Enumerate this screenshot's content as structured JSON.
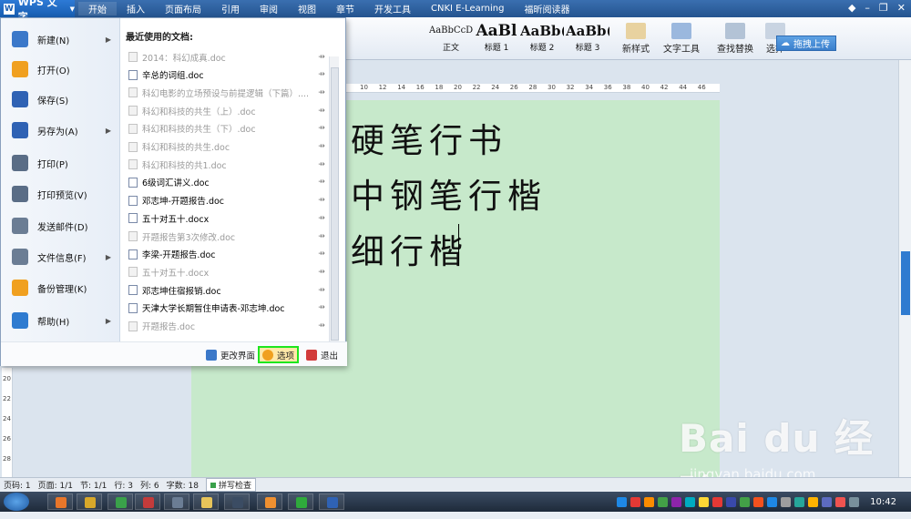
{
  "app": {
    "title": "WPS 文字",
    "logo": "W"
  },
  "menu_tabs": [
    "开始",
    "插入",
    "页面布局",
    "引用",
    "审阅",
    "视图",
    "章节",
    "开发工具",
    "CNKI E-Learning",
    "福昕阅读器"
  ],
  "ribbon": {
    "styles": [
      {
        "sample": "AaBbCcDd",
        "caption": "正文"
      },
      {
        "sample": "AaBl",
        "caption": "标题 1"
      },
      {
        "sample": "AaBb(",
        "caption": "标题 2"
      },
      {
        "sample": "AaBb(",
        "caption": "标题 3"
      }
    ],
    "buttons": [
      "新样式",
      "文字工具",
      "查找替换",
      "选择"
    ],
    "upload_label": "拖拽上传"
  },
  "ruler_ticks": [
    "10",
    "12",
    "14",
    "16",
    "18",
    "20",
    "22",
    "24",
    "26",
    "28",
    "30",
    "32",
    "34",
    "36",
    "38",
    "40",
    "42",
    "44",
    "46"
  ],
  "vruler_ticks": [
    "20",
    "22",
    "24",
    "26",
    "28"
  ],
  "document": {
    "lines": [
      "硬笔行书",
      "中钢笔行楷",
      "细行楷"
    ]
  },
  "file_menu": {
    "commands": [
      {
        "label": "新建(N)",
        "submenu": true,
        "icon": "new-doc-icon",
        "color": "#3b78c9"
      },
      {
        "label": "打开(O)",
        "submenu": false,
        "icon": "open-folder-icon",
        "color": "#f0a020"
      },
      {
        "label": "保存(S)",
        "submenu": false,
        "icon": "save-icon",
        "color": "#2f62b4"
      },
      {
        "label": "另存为(A)",
        "submenu": true,
        "icon": "save-as-icon",
        "color": "#2f62b4"
      },
      {
        "label": "打印(P)",
        "submenu": false,
        "icon": "print-icon",
        "color": "#5a6d86"
      },
      {
        "label": "打印预览(V)",
        "submenu": false,
        "icon": "print-preview-icon",
        "color": "#5a6d86"
      },
      {
        "label": "发送邮件(D)",
        "submenu": false,
        "icon": "mail-icon",
        "color": "#6b7d94"
      },
      {
        "label": "文件信息(F)",
        "submenu": true,
        "icon": "file-info-icon",
        "color": "#6b7d94"
      },
      {
        "label": "备份管理(K)",
        "submenu": false,
        "icon": "backup-icon",
        "color": "#f0a020"
      },
      {
        "label": "帮助(H)",
        "submenu": true,
        "icon": "help-icon",
        "color": "#2f7bd0"
      }
    ],
    "recent_title": "最近使用的文档:",
    "recent": [
      {
        "name": "2014：科幻成真.doc",
        "dim": true
      },
      {
        "name": "辛总的词组.doc",
        "dim": false
      },
      {
        "name": "科幻电影的立场预设与前提逻辑（下篇）....",
        "dim": true
      },
      {
        "name": "科幻和科技的共生（上）.doc",
        "dim": true
      },
      {
        "name": "科幻和科技的共生（下）.doc",
        "dim": true
      },
      {
        "name": "科幻和科技的共生.doc",
        "dim": true
      },
      {
        "name": "科幻和科技的共1.doc",
        "dim": true
      },
      {
        "name": "6级词汇讲义.doc",
        "dim": false
      },
      {
        "name": "邓志坤-开题报告.doc",
        "dim": false
      },
      {
        "name": "五十对五十.docx",
        "dim": false
      },
      {
        "name": "开题报告第3次修改.doc",
        "dim": true
      },
      {
        "name": "李梁-开题报告.doc",
        "dim": false
      },
      {
        "name": "五十对五十.docx",
        "dim": true
      },
      {
        "name": "邓志坤住宿报销.doc",
        "dim": false
      },
      {
        "name": "天津大学长期暂住申请表-邓志坤.doc",
        "dim": false
      },
      {
        "name": "开题报告.doc",
        "dim": true
      }
    ],
    "footer": {
      "change_ui": "更改界面",
      "options": "选项",
      "exit": "退出"
    }
  },
  "statusbar": {
    "page": "页码: 1",
    "pages": "页面: 1/1",
    "section": "节: 1/1",
    "row": "行: 3",
    "col": "列: 6",
    "words": "字数: 18",
    "spellcheck": "拼写检查"
  },
  "taskbar": {
    "clock": "10:42",
    "apps": [
      "#e8762a",
      "#d8a82a",
      "#3aa14a",
      "#c33b3b",
      "#6b7d94",
      "#e7c45a",
      "#3b4c63",
      "#f09030",
      "#2faa3c",
      "#2f62b4"
    ],
    "tray": [
      "#1e88e5",
      "#e53935",
      "#fb8c00",
      "#43a047",
      "#8e24aa",
      "#00acc1",
      "#fdd835",
      "#e53935",
      "#3949ab",
      "#43a047",
      "#f4511e",
      "#1e88e5",
      "#9e9e9e",
      "#26a69a",
      "#ffb300",
      "#5c6bc0",
      "#ef5350",
      "#78909c"
    ]
  },
  "watermark": {
    "brand": "Bai du 经验",
    "url": "jingyan.baidu.com"
  }
}
